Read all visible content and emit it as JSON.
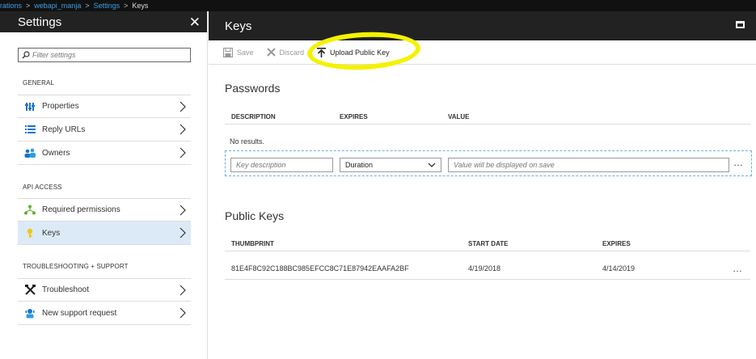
{
  "breadcrumb": {
    "items": [
      "rations",
      "webapi_manja",
      "Settings"
    ],
    "current": "Keys"
  },
  "settings": {
    "title": "Settings",
    "filter_placeholder": "Filter settings",
    "groups": {
      "general": "GENERAL",
      "api_access": "API ACCESS",
      "troubleshooting": "TROUBLESHOOTING + SUPPORT"
    },
    "items": [
      {
        "label": "Properties",
        "icon": "properties-icon"
      },
      {
        "label": "Reply URLs",
        "icon": "list-icon"
      },
      {
        "label": "Owners",
        "icon": "owners-icon"
      },
      {
        "label": "Required permissions",
        "icon": "permissions-icon"
      },
      {
        "label": "Keys",
        "icon": "key-icon",
        "active": true
      },
      {
        "label": "Troubleshoot",
        "icon": "wrench-icon"
      },
      {
        "label": "New support request",
        "icon": "support-icon"
      }
    ]
  },
  "keys": {
    "title": "Keys",
    "toolbar": {
      "save": "Save",
      "discard": "Discard",
      "upload": "Upload Public Key"
    },
    "passwords": {
      "title": "Passwords",
      "columns": [
        "DESCRIPTION",
        "EXPIRES",
        "VALUE"
      ],
      "empty": "No results.",
      "desc_placeholder": "Key description",
      "duration": "Duration",
      "value_placeholder": "Value will be displayed on save"
    },
    "public_keys": {
      "title": "Public Keys",
      "columns": [
        "THUMBPRINT",
        "START DATE",
        "EXPIRES"
      ],
      "rows": [
        {
          "thumbprint": "81E4F8C92C188BC985EFCC8C71E87942EAAFA2BF",
          "start": "4/19/2018",
          "expires": "4/14/2019"
        }
      ]
    }
  },
  "colors": {
    "header_bg": "#222222",
    "active_item": "#dceaf8",
    "link": "#3f9ee6",
    "highlight": "#f5f200"
  }
}
